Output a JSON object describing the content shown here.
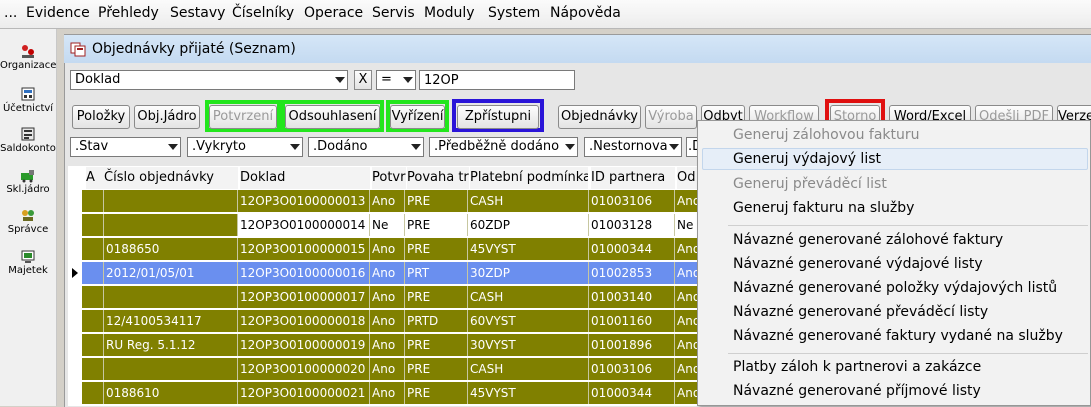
{
  "menubar": {
    "ellipsis": "...",
    "items": [
      "Evidence",
      "Přehledy",
      "Sestavy",
      "Číselníky",
      "Operace",
      "Servis",
      "Moduly",
      "System",
      "Nápověda"
    ]
  },
  "leftbar": {
    "items": [
      "Organizace",
      "Účetnictví",
      "Saldokonto",
      "Skl.jádro",
      "Správce",
      "Majetek"
    ]
  },
  "window": {
    "title": "Objednávky přijaté (Seznam)"
  },
  "filter": {
    "field": "Doklad",
    "clear": "X",
    "operator": "=",
    "value": "12OP"
  },
  "toolbar": {
    "buttons": [
      {
        "label": "Položky",
        "enabled": true
      },
      {
        "label": "Obj.Jádro",
        "enabled": true
      },
      {
        "label": "Potvrzení",
        "enabled": false
      },
      {
        "label": "Odsouhlasení",
        "enabled": true
      },
      {
        "label": "Vyřízení",
        "enabled": true
      },
      {
        "label": "Zpřístupni",
        "enabled": true
      },
      {
        "label": "Objednávky",
        "enabled": true
      },
      {
        "label": "Výroba",
        "enabled": false
      },
      {
        "label": "Odbyt",
        "enabled": true
      },
      {
        "label": "Workflow",
        "enabled": false
      },
      {
        "label": "Storno",
        "enabled": false
      },
      {
        "label": "Word/Excel",
        "enabled": true
      },
      {
        "label": "Odešli PDF",
        "enabled": false
      },
      {
        "label": "Verze",
        "enabled": true
      }
    ]
  },
  "filters2": [
    ".Stav",
    ".Vykryto",
    ".Dodáno",
    ".Předběžně dodáno",
    ".Nestornova",
    ".D"
  ],
  "grid": {
    "columns": [
      "A",
      "Číslo objednávky",
      "Doklad",
      "Potvr",
      "Povaha tr",
      "Platební podmínka",
      "ID partnera",
      "Od"
    ],
    "rows": [
      {
        "style": "olive",
        "a": "",
        "cislo": "",
        "doklad": "12OP3O0100000013",
        "potvr": "Ano",
        "povaha": "PRE",
        "plat": "CASH",
        "idp": "01003106",
        "od": "Ano"
      },
      {
        "style": "white",
        "a": "",
        "cislo": "",
        "doklad": "12OP3O0100000014",
        "potvr": "Ne",
        "povaha": "PRE",
        "plat": "60ZDP",
        "idp": "01003128",
        "od": "Ne"
      },
      {
        "style": "olive",
        "a": "",
        "cislo": "0188650",
        "doklad": "12OP3O0100000015",
        "potvr": "Ano",
        "povaha": "PRE",
        "plat": "45VYST",
        "idp": "01000344",
        "od": "Ano"
      },
      {
        "style": "sel",
        "a": "",
        "cislo": "2012/01/05/01",
        "doklad": "12OP3O0100000016",
        "potvr": "Ano",
        "povaha": "PRT",
        "plat": "30ZDP",
        "idp": "01002853",
        "od": "Ano"
      },
      {
        "style": "olive",
        "a": "",
        "cislo": "",
        "doklad": "12OP3O0100000017",
        "potvr": "Ano",
        "povaha": "PRE",
        "plat": "CASH",
        "idp": "01003140",
        "od": "Ano"
      },
      {
        "style": "olive",
        "a": "",
        "cislo": "12/4100534117",
        "doklad": "12OP3O0100000018",
        "potvr": "Ano",
        "povaha": "PRTD",
        "plat": "60VYST",
        "idp": "01001160",
        "od": "Ano"
      },
      {
        "style": "olive",
        "a": "",
        "cislo": "RU Reg. 5.1.12",
        "doklad": "12OP3O0100000019",
        "potvr": "Ano",
        "povaha": "PRE",
        "plat": "30VYST",
        "idp": "01001896",
        "od": "Ano"
      },
      {
        "style": "olive",
        "a": "",
        "cislo": "",
        "doklad": "12OP3O0100000020",
        "potvr": "Ano",
        "povaha": "PRE",
        "plat": "CASH",
        "idp": "01003106",
        "od": "Ano"
      },
      {
        "style": "olive",
        "a": "",
        "cislo": "0188610",
        "doklad": "12OP3O0100000021",
        "potvr": "Ano",
        "povaha": "PRE",
        "plat": "45VYST",
        "idp": "01000344",
        "od": "Ano"
      }
    ]
  },
  "context_menu": {
    "items": [
      {
        "label": "Generuj zálohovou fakturu",
        "enabled": false
      },
      {
        "label": "Generuj výdajový list",
        "enabled": true,
        "hover": true
      },
      {
        "label": "Generuj převáděcí list",
        "enabled": false
      },
      {
        "label": "Generuj fakturu na služby",
        "enabled": true
      },
      {
        "label": "Návazné generované zálohové faktury",
        "enabled": true
      },
      {
        "label": "Návazné generované výdajové listy",
        "enabled": true
      },
      {
        "label": "Návazné generované položky výdajových listů",
        "enabled": true
      },
      {
        "label": "Návazné generované převáděcí listy",
        "enabled": true
      },
      {
        "label": "Návazné generované faktury vydané na služby",
        "enabled": true
      },
      {
        "label": "Platby záloh k partnerovi a zakázce",
        "enabled": true
      },
      {
        "label": "Návazné generované příjmové listy",
        "enabled": true
      }
    ]
  },
  "colors": {
    "olive_row": "#808000",
    "selected_row": "#6a8fef",
    "highlight_green": "#22e61c",
    "highlight_blue": "#2a14d8",
    "highlight_red": "#e01010"
  }
}
